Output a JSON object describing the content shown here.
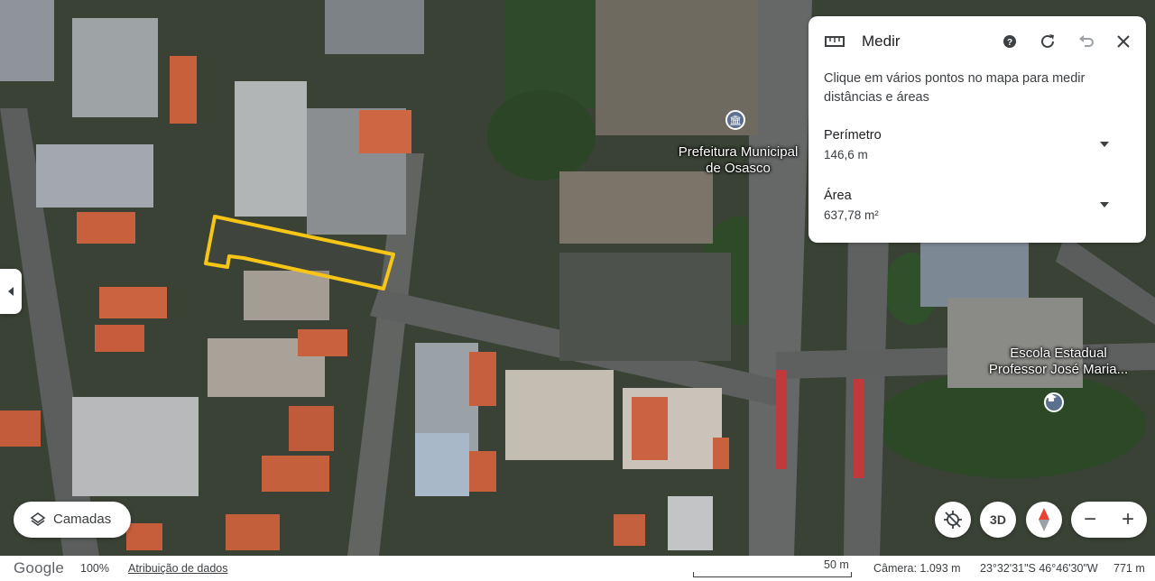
{
  "map": {
    "pois": [
      {
        "name": "Prefeitura Municipal de Osasco",
        "line1": "Prefeitura Municipal",
        "line2": "de Osasco",
        "icon": "landmark-icon"
      },
      {
        "name": "Escola Estadual Professor José Maria...",
        "line1": "Escola Estadual",
        "line2": "Professor José Maria...",
        "icon": "school-icon"
      }
    ],
    "highlight_color": "#f6c517"
  },
  "measure_panel": {
    "title": "Medir",
    "description": "Clique em vários pontos no mapa para medir distâncias e áreas",
    "perimeter_label": "Perímetro",
    "perimeter_value": "146,6 m",
    "area_label": "Área",
    "area_value": "637,78 m²",
    "icons": [
      "ruler-icon",
      "help-icon",
      "refresh-icon",
      "undo-icon",
      "close-icon",
      "caret-down-icon"
    ]
  },
  "controls": {
    "layers_label": "Camadas",
    "threed_label": "3D",
    "zoom_out": "−",
    "zoom_in": "+"
  },
  "bottom_bar": {
    "logo": "Google",
    "zoom_percent": "100%",
    "attribution": "Atribuição de dados",
    "scale_label": "50 m",
    "camera": "Câmera: 1.093 m",
    "coordinates": "23°32'31\"S 46°46'30\"W",
    "altitude": "771 m"
  },
  "colors": {
    "accent": "#1a73e8",
    "panel_bg": "#ffffff",
    "text": "#202124"
  }
}
